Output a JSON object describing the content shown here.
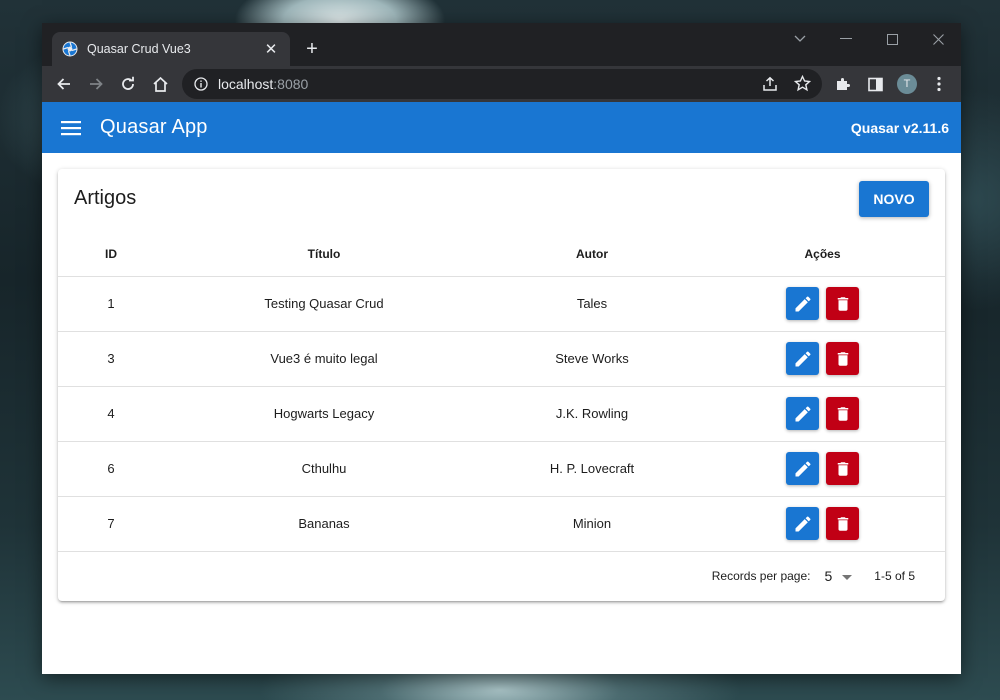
{
  "browser": {
    "tab_title": "Quasar Crud Vue3",
    "url_host": "localhost",
    "url_port": ":8080",
    "profile_initial": "T"
  },
  "app": {
    "title": "Quasar App",
    "version": "Quasar v2.11.6"
  },
  "card": {
    "title": "Artigos",
    "new_button": "NOVO"
  },
  "table": {
    "columns": [
      "ID",
      "Título",
      "Autor",
      "Ações"
    ],
    "rows": [
      {
        "id": "1",
        "titulo": "Testing Quasar Crud",
        "autor": "Tales"
      },
      {
        "id": "3",
        "titulo": "Vue3 é muito legal",
        "autor": "Steve Works"
      },
      {
        "id": "4",
        "titulo": "Hogwarts Legacy",
        "autor": "J.K. Rowling"
      },
      {
        "id": "6",
        "titulo": "Cthulhu",
        "autor": "H. P. Lovecraft"
      },
      {
        "id": "7",
        "titulo": "Bananas",
        "autor": "Minion"
      }
    ]
  },
  "pagination": {
    "records_label": "Records per page:",
    "records_value": "5",
    "range": "1-5 of 5"
  },
  "colors": {
    "primary": "#1976d2",
    "negative": "#c10015"
  }
}
